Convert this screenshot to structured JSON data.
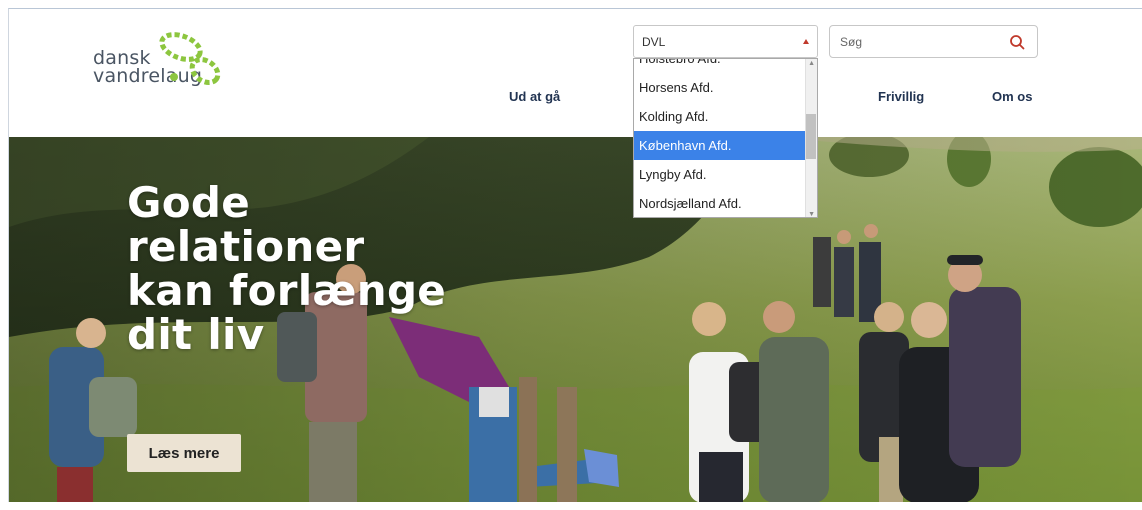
{
  "logo": {
    "line1": "dansk",
    "line2": "vandrelaug"
  },
  "colors": {
    "logo_green": "#8dc63f",
    "nav": "#223452",
    "selection": "#3b82e8",
    "search_icon": "#c0392b",
    "cta_bg": "#ece3d3"
  },
  "nav": {
    "items": [
      "Ud at gå",
      "Frivillig",
      "Om os"
    ]
  },
  "dropdown": {
    "selected_value": "DVL",
    "options": [
      "Holstebro Afd.",
      "Horsens Afd.",
      "Kolding Afd.",
      "København Afd.",
      "Lyngby Afd.",
      "Nordsjælland Afd."
    ],
    "highlighted": "København Afd."
  },
  "search": {
    "placeholder": "Søg",
    "icon": "search-icon"
  },
  "hero": {
    "title_lines": [
      "Gode",
      "relationer",
      "kan forlænge",
      "dit liv"
    ],
    "cta_label": "Læs mere"
  }
}
